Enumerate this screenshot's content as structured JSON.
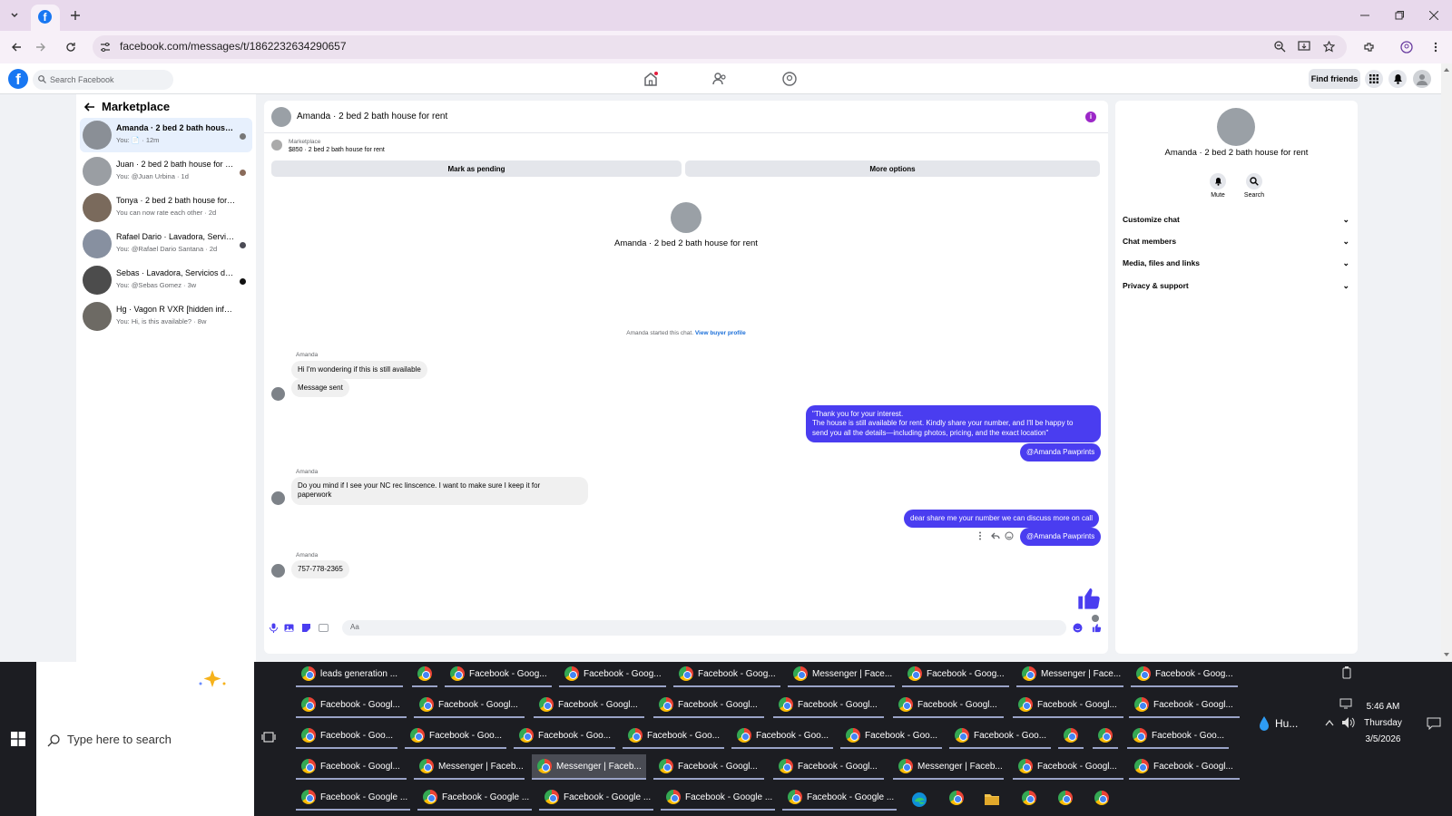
{
  "browser": {
    "url": "facebook.com/messages/t/1862232634290657"
  },
  "fb": {
    "search_placeholder": "Search Facebook",
    "find_friends": "Find friends"
  },
  "left": {
    "title": "Marketplace",
    "conversations": [
      {
        "name": "Amanda · 2 bed 2 bath house fo...",
        "sub": "You: 📄 · 12m"
      },
      {
        "name": "Juan · 2 bed 2 bath house for rent",
        "sub": "You: @Juan Urbina · 1d"
      },
      {
        "name": "Tonya · 2 bed 2 bath house for rent",
        "sub": "You can now rate each other · 2d"
      },
      {
        "name": "Rafael Dario · Lavadora, Servicio...",
        "sub": "You: @Rafael Dario Santana · 2d"
      },
      {
        "name": "Sebas · Lavadora, Servicios de re...",
        "sub": "You: @Sebas Gomez · 3w"
      },
      {
        "name": "Hg · Vagon R VXR [hidden informa...",
        "sub": "You: Hi, is this available? · 8w"
      }
    ]
  },
  "chat": {
    "title": "Amanda · 2 bed 2 bath house for rent",
    "marketplace_label": "Marketplace",
    "listing": "$850 · 2 bed 2 bath house for rent",
    "mark_pending": "Mark as pending",
    "more_options": "More options",
    "profile_name": "Amanda · 2 bed 2 bath house for rent",
    "started_text": "Amanda started this chat.",
    "view_buyer": "View buyer profile",
    "sender": "Amanda",
    "messages": {
      "in1": "Hi I'm wondering if this is still available",
      "in2": "Message sent",
      "out1_l1": "\"Thank you for your interest.",
      "out1_l2": "The house is still available for rent. Kindly share your number, and I'll be happy to",
      "out1_l3": "send you all the details—including photos, pricing, and the exact location\"",
      "out_tag": "@Amanda Pawprints",
      "in3_l1": "Do you mind if I see your NC rec linscence. I want to make sure I keep it for",
      "in3_l2": "paperwork",
      "out2": "dear share me your number we can discuss more on call",
      "in4": "757-778-2365"
    },
    "composer_placeholder": "Aa"
  },
  "right": {
    "name": "Amanda · 2 bed 2 bath house for rent",
    "mute": "Mute",
    "search": "Search",
    "rows": [
      "Customize chat",
      "Chat members",
      "Media, files and links",
      "Privacy & support"
    ]
  },
  "taskbar": {
    "search_placeholder": "Type here to search",
    "rows": [
      [
        "leads generation ...",
        "",
        "Facebook - Goog...",
        "Facebook - Goog...",
        "Facebook - Goog...",
        "Messenger | Face...",
        "Facebook - Goog...",
        "Messenger | Face...",
        "Facebook - Goog..."
      ],
      [
        "Facebook - Googl...",
        "Facebook - Googl...",
        "Facebook - Googl...",
        "Facebook - Googl...",
        "Facebook - Googl...",
        "Facebook - Googl...",
        "Facebook - Googl...",
        "Facebook - Googl..."
      ],
      [
        "Facebook - Goo...",
        "Facebook - Goo...",
        "Facebook - Goo...",
        "Facebook - Goo...",
        "Facebook - Goo...",
        "Facebook - Goo...",
        "Facebook - Goo...",
        "",
        "",
        "Facebook - Goo..."
      ],
      [
        "Facebook - Googl...",
        "Messenger | Faceb...",
        "Messenger | Faceb...",
        "Facebook - Googl...",
        "Facebook - Googl...",
        "Messenger | Faceb...",
        "Facebook - Googl...",
        "Facebook - Googl..."
      ],
      [
        "Facebook - Google ...",
        "Facebook - Google ...",
        "Facebook - Google ...",
        "Facebook - Google ...",
        "Facebook - Google ..."
      ]
    ],
    "weather": "Hu...",
    "time": "5:46 AM",
    "day": "Thursday",
    "date": "3/5/2026"
  },
  "colors": {
    "accent": "#4a3df0",
    "fb_blue": "#1877f2",
    "tab_bg": "#e8d9ec"
  }
}
